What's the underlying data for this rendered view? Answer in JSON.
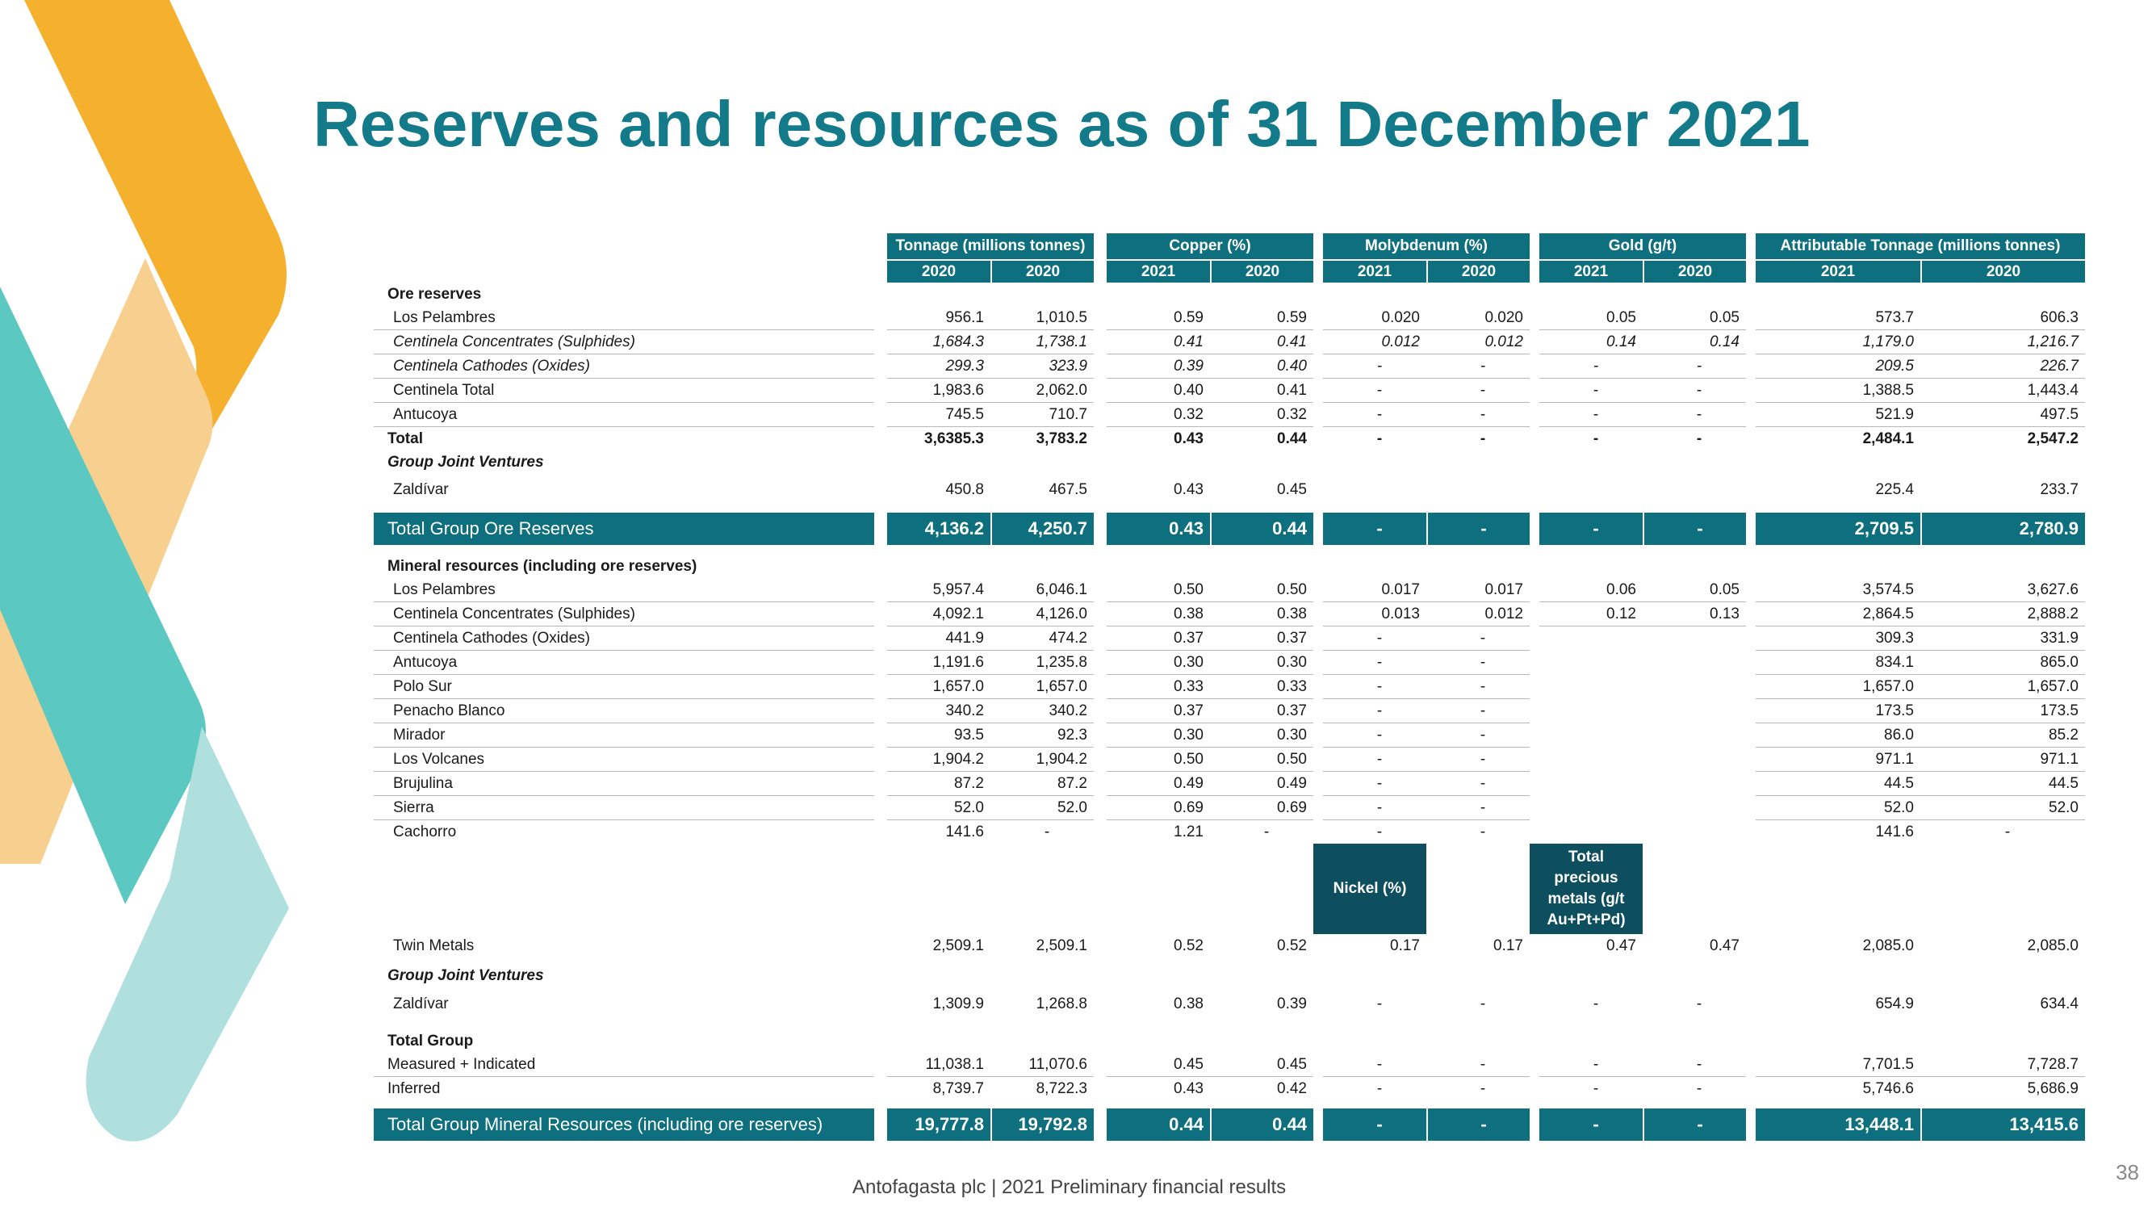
{
  "title": "Reserves and resources as of 31 December 2021",
  "column_groups": [
    {
      "label": "Tonnage (millions tonnes)",
      "years": [
        "2020",
        "2020"
      ]
    },
    {
      "label": "Copper (%)",
      "years": [
        "2021",
        "2020"
      ]
    },
    {
      "label": "Molybdenum (%)",
      "years": [
        "2021",
        "2020"
      ]
    },
    {
      "label": "Gold (g/t)",
      "years": [
        "2021",
        "2020"
      ]
    },
    {
      "label": "Attributable Tonnage (millions tonnes)",
      "years": [
        "2021",
        "2020"
      ]
    }
  ],
  "ore_reserves": {
    "heading": "Ore reserves",
    "rows": [
      {
        "label": "Los Pelambres",
        "values": [
          "956.1",
          "1,010.5",
          "0.59",
          "0.59",
          "0.020",
          "0.020",
          "0.05",
          "0.05",
          "573.7",
          "606.3"
        ]
      },
      {
        "label": "Centinela Concentrates (Sulphides)",
        "values": [
          "1,684.3",
          "1,738.1",
          "0.41",
          "0.41",
          "0.012",
          "0.012",
          "0.14",
          "0.14",
          "1,179.0",
          "1,216.7"
        ]
      },
      {
        "label": "Centinela Cathodes (Oxides)",
        "values": [
          "299.3",
          "323.9",
          "0.39",
          "0.40",
          "-",
          "-",
          "-",
          "-",
          "209.5",
          "226.7"
        ]
      },
      {
        "label": "Centinela Total",
        "values": [
          "1,983.6",
          "2,062.0",
          "0.40",
          "0.41",
          "-",
          "-",
          "-",
          "-",
          "1,388.5",
          "1,443.4"
        ]
      },
      {
        "label": "Antucoya",
        "values": [
          "745.5",
          "710.7",
          "0.32",
          "0.32",
          "-",
          "-",
          "-",
          "-",
          "521.9",
          "497.5"
        ]
      },
      {
        "label": "Total",
        "values": [
          "3,6385.3",
          "3,783.2",
          "0.43",
          "0.44",
          "-",
          "-",
          "-",
          "-",
          "2,484.1",
          "2,547.2"
        ]
      }
    ],
    "jv_heading": "Group Joint Ventures",
    "jv_row": {
      "label": "Zaldívar",
      "values": [
        "450.8",
        "467.5",
        "0.43",
        "0.45",
        "",
        "",
        "",
        "",
        "225.4",
        "233.7"
      ]
    },
    "total": {
      "label": "Total Group Ore Reserves",
      "values": [
        "4,136.2",
        "4,250.7",
        "0.43",
        "0.44",
        "-",
        "-",
        "-",
        "-",
        "2,709.5",
        "2,780.9"
      ]
    }
  },
  "mineral_resources": {
    "heading": "Mineral resources (including ore reserves)",
    "rows": [
      {
        "label": "Los Pelambres",
        "values": [
          "5,957.4",
          "6,046.1",
          "0.50",
          "0.50",
          "0.017",
          "0.017",
          "0.06",
          "0.05",
          "3,574.5",
          "3,627.6"
        ]
      },
      {
        "label": "Centinela Concentrates (Sulphides)",
        "values": [
          "4,092.1",
          "4,126.0",
          "0.38",
          "0.38",
          "0.013",
          "0.012",
          "0.12",
          "0.13",
          "2,864.5",
          "2,888.2"
        ]
      },
      {
        "label": "Centinela Cathodes (Oxides)",
        "values": [
          "441.9",
          "474.2",
          "0.37",
          "0.37",
          "-",
          "-",
          "",
          "",
          "309.3",
          "331.9"
        ]
      },
      {
        "label": "Antucoya",
        "values": [
          "1,191.6",
          "1,235.8",
          "0.30",
          "0.30",
          "-",
          "-",
          "",
          "",
          "834.1",
          "865.0"
        ]
      },
      {
        "label": "Polo Sur",
        "values": [
          "1,657.0",
          "1,657.0",
          "0.33",
          "0.33",
          "-",
          "-",
          "",
          "",
          "1,657.0",
          "1,657.0"
        ]
      },
      {
        "label": "Penacho Blanco",
        "values": [
          "340.2",
          "340.2",
          "0.37",
          "0.37",
          "-",
          "-",
          "",
          "",
          "173.5",
          "173.5"
        ]
      },
      {
        "label": "Mirador",
        "values": [
          "93.5",
          "92.3",
          "0.30",
          "0.30",
          "-",
          "-",
          "",
          "",
          "86.0",
          "85.2"
        ]
      },
      {
        "label": "Los Volcanes",
        "values": [
          "1,904.2",
          "1,904.2",
          "0.50",
          "0.50",
          "-",
          "-",
          "",
          "",
          "971.1",
          "971.1"
        ]
      },
      {
        "label": "Brujulina",
        "values": [
          "87.2",
          "87.2",
          "0.49",
          "0.49",
          "-",
          "-",
          "",
          "",
          "44.5",
          "44.5"
        ]
      },
      {
        "label": "Sierra",
        "values": [
          "52.0",
          "52.0",
          "0.69",
          "0.69",
          "-",
          "-",
          "",
          "",
          "52.0",
          "52.0"
        ]
      },
      {
        "label": "Cachorro",
        "values": [
          "141.6",
          "-",
          "1.21",
          "-",
          "-",
          "-",
          "",
          "",
          "141.6",
          "-"
        ]
      }
    ],
    "nickel_header": "Nickel (%)",
    "precious_header": "Total precious metals (g/t Au+Pt+Pd)",
    "twin_metals": {
      "label": "Twin Metals",
      "values": [
        "2,509.1",
        "2,509.1",
        "0.52",
        "0.52",
        "0.17",
        "0.17",
        "0.47",
        "0.47",
        "2,085.0",
        "2,085.0"
      ]
    },
    "jv_heading": "Group Joint Ventures",
    "jv_row": {
      "label": "Zaldívar",
      "values": [
        "1,309.9",
        "1,268.8",
        "0.38",
        "0.39",
        "-",
        "-",
        "-",
        "-",
        "654.9",
        "634.4"
      ]
    },
    "group_heading": "Total Group",
    "group_rows": [
      {
        "label": "Measured + Indicated",
        "values": [
          "11,038.1",
          "11,070.6",
          "0.45",
          "0.45",
          "-",
          "-",
          "-",
          "-",
          "7,701.5",
          "7,728.7"
        ]
      },
      {
        "label": "Inferred",
        "values": [
          "8,739.7",
          "8,722.3",
          "0.43",
          "0.42",
          "-",
          "-",
          "-",
          "-",
          "5,746.6",
          "5,686.9"
        ]
      }
    ],
    "total": {
      "label": "Total Group Mineral Resources (including ore reserves)",
      "values": [
        "19,777.8",
        "19,792.8",
        "0.44",
        "0.44",
        "-",
        "-",
        "-",
        "-",
        "13,448.1",
        "13,415.6"
      ]
    }
  },
  "footer": "Antofagasta plc | 2021 Preliminary financial results",
  "page_number": "38",
  "colors": {
    "teal": "#0e6f7f",
    "title": "#137a8a",
    "orange": "#f4b13c",
    "light_orange": "#f8cf8a",
    "aqua": "#5ec7c4",
    "light_aqua": "#b0e0e0"
  }
}
